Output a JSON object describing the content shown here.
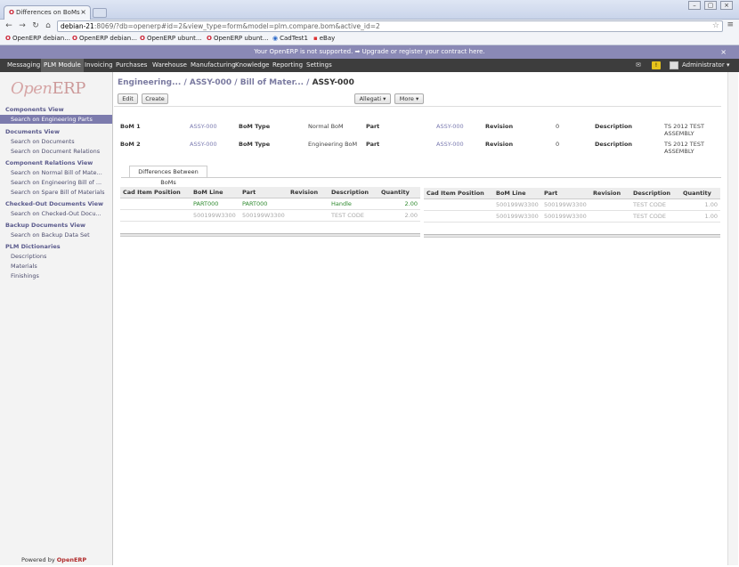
{
  "browser": {
    "tab_title": "Differences on BoMs -",
    "url_host": "debian-21",
    "url_rest": ":8069/?db=openerp#id=2&view_type=form&model=plm.compare.bom&active_id=2",
    "bookmarks": [
      "OpenERP debian...",
      "OpenERP debian...",
      "OpenERP ubunt...",
      "OpenERP ubunt...",
      "CadTest1",
      "eBay"
    ]
  },
  "announcement": {
    "text": "Your OpenERP is not supported. ➡ Upgrade or register your contract here."
  },
  "topnav": {
    "items": [
      "Messaging",
      "PLM Module",
      "Invoicing",
      "Purchases",
      "Warehouse",
      "Manufacturing",
      "Knowledge",
      "Reporting",
      "Settings"
    ],
    "user": "Administrator ▾"
  },
  "sidebar": {
    "logo_open": "Open",
    "logo_erp": "ERP",
    "sections": [
      {
        "title": "Components View",
        "items": [
          "Search on Engineering Parts"
        ]
      },
      {
        "title": "Documents View",
        "items": [
          "Search on Documents",
          "Search on Document Relations"
        ]
      },
      {
        "title": "Component Relations View",
        "items": [
          "Search on Normal Bill of Mate...",
          "Search on Engineering Bill of ...",
          "Search on Spare Bill of Materials"
        ]
      },
      {
        "title": "Checked-Out Documents View",
        "items": [
          "Search on Checked-Out Docu..."
        ]
      },
      {
        "title": "Backup Documents View",
        "items": [
          "Search on Backup Data Set"
        ]
      },
      {
        "title": "PLM Dictionaries",
        "items": [
          "Descriptions",
          "Materials",
          "Finishings"
        ]
      }
    ],
    "powered_by": "Powered by",
    "powered_brand": "OpenERP"
  },
  "breadcrumb": {
    "items": [
      "Engineering...",
      "ASSY-000",
      "Bill of Mater..."
    ],
    "current": "ASSY-000"
  },
  "buttons": {
    "edit": "Edit",
    "create": "Create",
    "allegati": "Allegati ▾",
    "more": "More ▾"
  },
  "form": {
    "rows": [
      {
        "label": "BoM 1",
        "bom": "ASSY-000",
        "type_label": "BoM Type",
        "type_value": "Normal BoM",
        "part_label": "Part",
        "part": "ASSY-000",
        "rev_label": "Revision",
        "rev": "0",
        "desc_label": "Description",
        "desc1": "TS 2012 TEST",
        "desc2": "ASSEMBLY"
      },
      {
        "label": "BoM 2",
        "bom": "ASSY-000",
        "type_label": "BoM Type",
        "type_value": "Engineering BoM",
        "part_label": "Part",
        "part": "ASSY-000",
        "rev_label": "Revision",
        "rev": "0",
        "desc_label": "Description",
        "desc1": "TS 2012 TEST",
        "desc2": "ASSEMBLY"
      }
    ]
  },
  "notebook": {
    "tab": "Differences Between BoMs"
  },
  "tables": {
    "columns": [
      "Cad Item Position",
      "BoM Line",
      "Part",
      "Revision",
      "Description",
      "Quantity"
    ],
    "left_rows": [
      {
        "pos": "",
        "line": "PART000",
        "part": "PART000",
        "rev": "",
        "desc": "Handle",
        "qty": "2.00",
        "style": "green"
      },
      {
        "pos": "",
        "line": "500199W3300",
        "part": "500199W3300",
        "rev": "",
        "desc": "TEST CODE",
        "qty": "2.00",
        "style": "grey"
      }
    ],
    "right_rows": [
      {
        "pos": "",
        "line": "500199W3300",
        "part": "500199W3300",
        "rev": "",
        "desc": "TEST CODE",
        "qty": "1.00",
        "style": "grey"
      },
      {
        "pos": "",
        "line": "500199W3300",
        "part": "500199W3300",
        "rev": "",
        "desc": "TEST CODE",
        "qty": "1.00",
        "style": "grey"
      }
    ]
  },
  "colors": {
    "topnav": "#3d3d3d",
    "announcement": "#8a89b5",
    "sidebar_active": "#7c7bad",
    "link": "#7a7ab0",
    "added": "#2e8a2e"
  }
}
